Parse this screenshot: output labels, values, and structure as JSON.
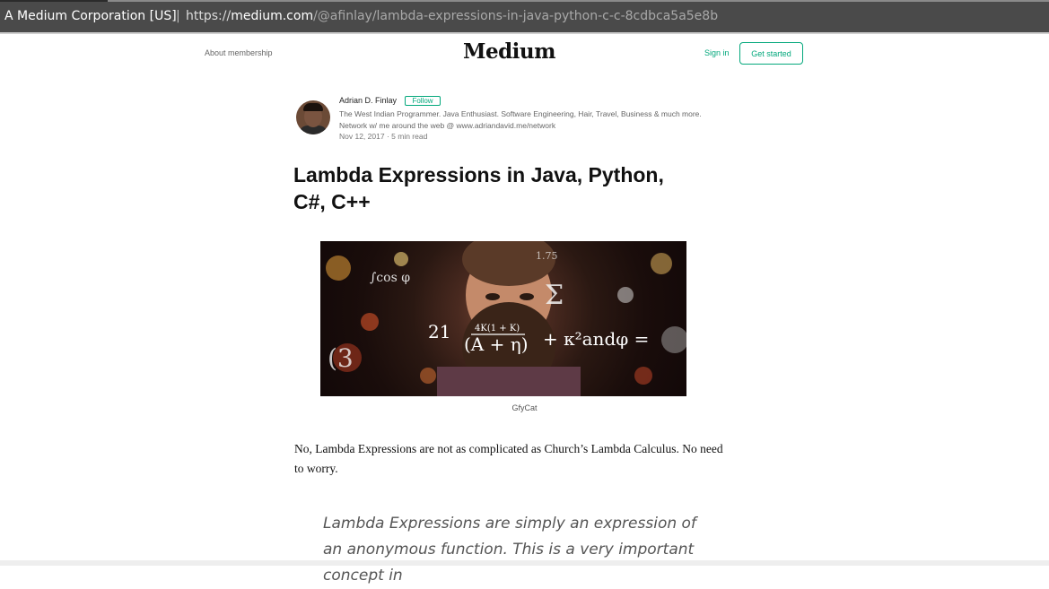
{
  "browser": {
    "origin_label": "A Medium Corporation [US]",
    "url_scheme": "https://",
    "url_host": "medium.com",
    "url_path": "/@afinlay/lambda-expressions-in-java-python-c-c-8cdbca5a5e8b"
  },
  "header": {
    "about_label": "About membership",
    "logo_text": "Medium",
    "signin_label": "Sign in",
    "get_started_label": "Get started"
  },
  "author": {
    "name": "Adrian D. Finlay",
    "follow_label": "Follow",
    "bio": "The West Indian Programmer. Java Enthusiast. Software Engineering, Hair, Travel, Business & much more. Network w/ me around the web @ www.adriandavid.me/network",
    "date": "Nov 12, 2017",
    "read_time": "5 min read"
  },
  "article": {
    "title": "Lambda Expressions in Java, Python, C#, C++",
    "image_caption": "GfyCat",
    "image_text": {
      "formula_main": "21",
      "formula_numer": "4K(1 + K)",
      "formula_denom": "(A + η)",
      "formula_tail": "+ κ²andφ =",
      "cos": "∫cos φ",
      "sigma": "Σ",
      "big3": "(3",
      "misc": "1.75"
    },
    "paragraph": "No, Lambda Expressions are not as complicated as Church’s Lambda Calculus. No need to worry.",
    "quote": "Lambda Expressions are simply an expression of an anonymous function. This is a very important concept in"
  }
}
